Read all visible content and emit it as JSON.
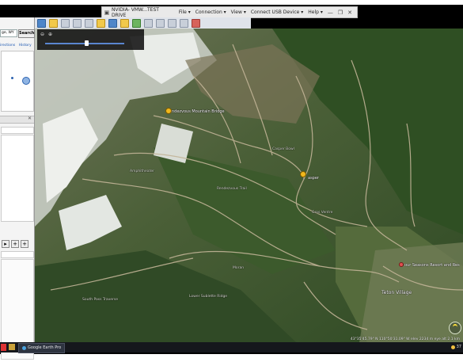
{
  "vm_bar": {
    "title": "NVIDIA- VMW...TEST DRIVE",
    "menus": [
      "File ▾",
      "Connection ▾",
      "View ▾",
      "Connect USB Device ▾",
      "Help ▾"
    ]
  },
  "sidebar": {
    "search_value": "ge, WY",
    "search_button": "Search",
    "directions_link": "irections",
    "history_link": "History"
  },
  "map": {
    "labels": {
      "mountain": "ndezvous Mountain Bridge",
      "casper": "asper",
      "village": "Teton Village",
      "resort": "our Seasons Resort and Res",
      "trail1": "Amphitheater",
      "trail2": "Rendezvous Trail",
      "trail3": "Gros Ventre",
      "trail4": "Lower Sublette Ridge",
      "trail5": "Casper Bowl",
      "trail6": "Moran",
      "trail7": "South Pass Traverse"
    },
    "status": "43°35'45.79\" N 110°50'31.09\" W elev 2234 m eye alt 2.1 km",
    "colors": {
      "forest": "#3f5a30",
      "snow": "#e8ece9",
      "road": "#b9a98c"
    }
  },
  "taskbar": {
    "app_label": "Google Earth Pro",
    "clock": "37"
  }
}
